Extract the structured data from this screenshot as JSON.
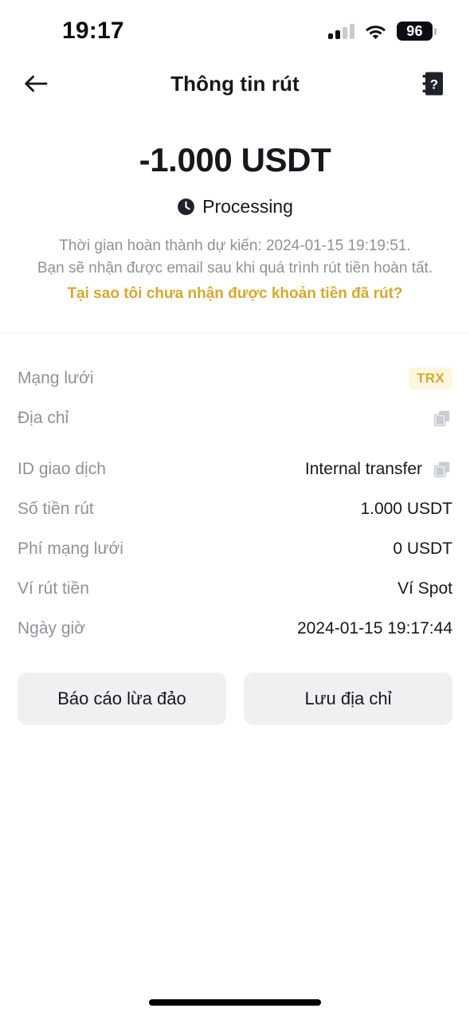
{
  "status_bar": {
    "time": "19:17",
    "battery_level": "96",
    "signal_icon": "cellular-signal-icon",
    "wifi_icon": "wifi-icon",
    "battery_icon": "battery-icon"
  },
  "nav": {
    "back_icon": "back-arrow-icon",
    "title": "Thông tin rút",
    "help_icon": "help-book-icon"
  },
  "summary": {
    "amount": "-1.000 USDT",
    "status_icon": "clock-icon",
    "status_text": "Processing",
    "note_line1": "Thời gian hoàn thành dự kiến: 2024-01-15 19:19:51.",
    "note_line2": "Bạn sẽ nhận được email sau khi quá trình rút tiền hoàn tất.",
    "note_link": "Tại sao tôi chưa nhận được khoản tiền đã rút?"
  },
  "details": {
    "network": {
      "label": "Mạng lưới",
      "badge": "TRX"
    },
    "address": {
      "label": "Địa chỉ",
      "value": "",
      "copy_icon": "copy-icon"
    },
    "rows": [
      {
        "label": "ID giao dịch",
        "value": "Internal transfer",
        "has_copy": true,
        "copy_icon": "copy-icon"
      },
      {
        "label": "Số tiền rút",
        "value": "1.000 USDT",
        "has_copy": false
      },
      {
        "label": "Phí mạng lưới",
        "value": "0 USDT",
        "has_copy": false
      },
      {
        "label": "Ví rút tiền",
        "value": "Ví Spot",
        "has_copy": false
      },
      {
        "label": "Ngày giờ",
        "value": "2024-01-15 19:17:44",
        "has_copy": false
      }
    ]
  },
  "actions": {
    "report_scam": "Báo cáo lừa đảo",
    "save_address": "Lưu địa chỉ"
  },
  "colors": {
    "accent_gold": "#d6a92f",
    "badge_bg": "#fdf6df",
    "text_primary": "#16181d",
    "text_muted": "#8e9299",
    "button_bg": "#eff0f2"
  }
}
